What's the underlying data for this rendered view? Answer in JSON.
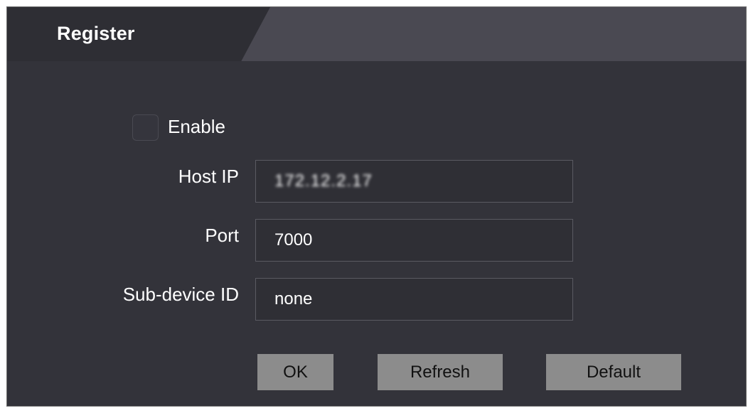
{
  "panel": {
    "tab_title": "Register"
  },
  "form": {
    "enable": {
      "label": "Enable",
      "checked": false
    },
    "host_ip": {
      "label": "Host IP",
      "value": "172.12.2.17"
    },
    "port": {
      "label": "Port",
      "value": "7000"
    },
    "sub_device_id": {
      "label": "Sub-device ID",
      "value": "none"
    }
  },
  "buttons": {
    "ok": "OK",
    "refresh": "Refresh",
    "default": "Default"
  },
  "colors": {
    "background": "#33333a",
    "tab_active": "#2e2e34",
    "tab_bar": "#4a4952",
    "button": "#8c8c8c",
    "text": "#ffffff"
  }
}
